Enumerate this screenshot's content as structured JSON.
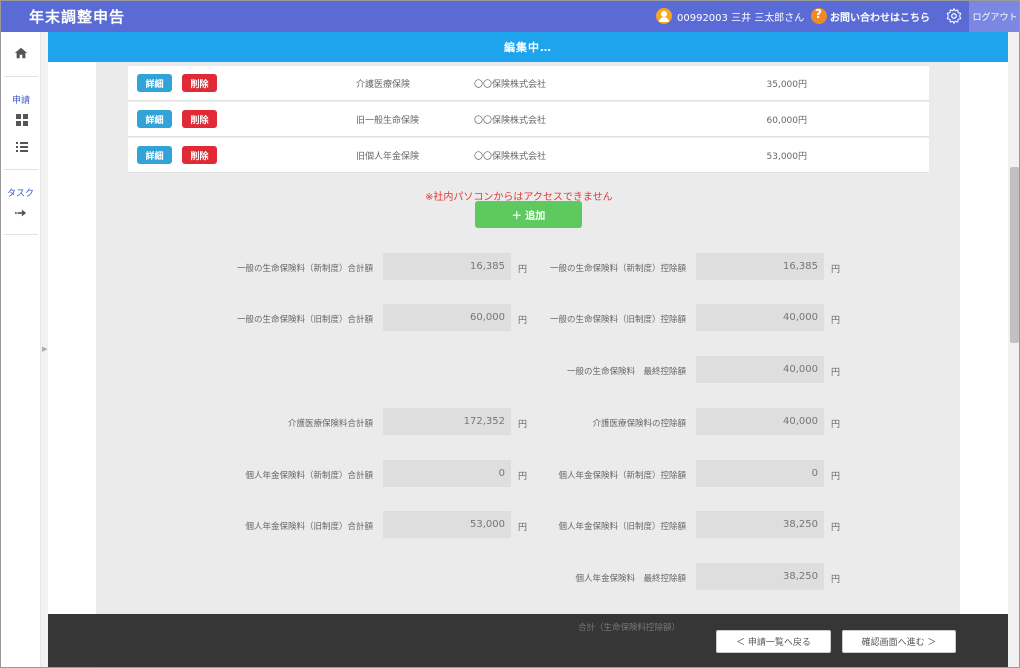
{
  "header": {
    "app_title": "年末調整申告",
    "user_label": "00992003 三井 三太郎さん",
    "contact_label": "お問い合わせはこちら",
    "logout_label": "ログアウト"
  },
  "sidebar": {
    "apply_label": "申請",
    "task_label": "タスク"
  },
  "editing_banner": "編集中…",
  "rows": [
    {
      "detail": "詳細",
      "delete": "削除",
      "type": "介護医療保険",
      "company": "〇〇保険株式会社",
      "amount": "35,000円"
    },
    {
      "detail": "詳細",
      "delete": "削除",
      "type": "旧一般生命保険",
      "company": "〇〇保険株式会社",
      "amount": "60,000円"
    },
    {
      "detail": "詳細",
      "delete": "削除",
      "type": "旧個人年金保険",
      "company": "〇〇保険株式会社",
      "amount": "53,000円"
    }
  ],
  "warning": "※社内パソコンからはアクセスできません",
  "add_button": "＋ 追加",
  "unit": "円",
  "fields": {
    "gen_new_total_label": "一般の生命保険料（新制度）合計額",
    "gen_new_total": "16,385",
    "gen_new_deduct_label": "一般の生命保険料（新制度）控除額",
    "gen_new_deduct": "16,385",
    "gen_old_total_label": "一般の生命保険料（旧制度）合計額",
    "gen_old_total": "60,000",
    "gen_old_deduct_label": "一般の生命保険料（旧制度）控除額",
    "gen_old_deduct": "40,000",
    "gen_final_label": "一般の生命保険料　最終控除額",
    "gen_final": "40,000",
    "care_total_label": "介護医療保険料合計額",
    "care_total": "172,352",
    "care_deduct_label": "介護医療保険料の控除額",
    "care_deduct": "40,000",
    "pension_new_total_label": "個人年金保険料（新制度）合計額",
    "pension_new_total": "0",
    "pension_new_deduct_label": "個人年金保険料（新制度）控除額",
    "pension_new_deduct": "0",
    "pension_old_total_label": "個人年金保険料（旧制度）合計額",
    "pension_old_total": "53,000",
    "pension_old_deduct_label": "個人年金保険料（旧制度）控除額",
    "pension_old_deduct": "38,250",
    "pension_final_label": "個人年金保険料　最終控除額",
    "pension_final": "38,250",
    "grand_total_label": "合計（生命保険料控除額）"
  },
  "footer": {
    "back_label": "＜ 申請一覧へ戻る",
    "next_label": "確認画面へ進む ＞"
  },
  "colors": {
    "header": "#5a6bd6",
    "banner": "#1ea4ec",
    "detail_button": "#31a3d6",
    "delete_button": "#e02a36",
    "add_button": "#5dc95f",
    "warning": "#e0393b"
  }
}
